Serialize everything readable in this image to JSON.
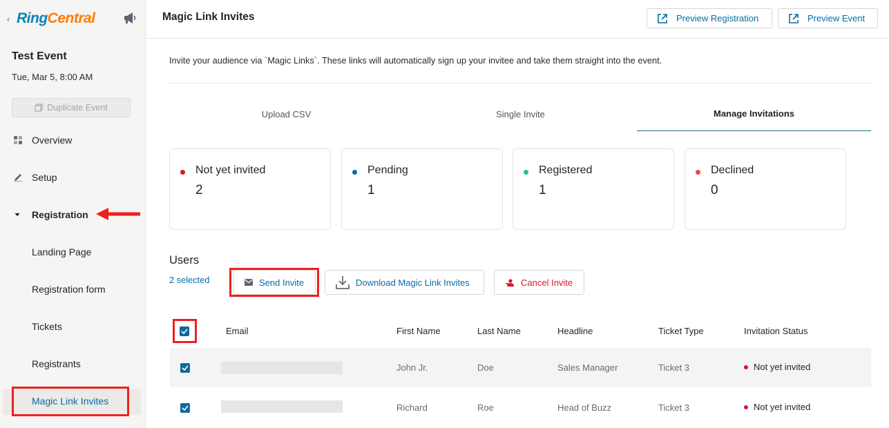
{
  "app": {
    "logo_ring": "Ring",
    "logo_central": "Central",
    "back_icon": "chevron-left-icon",
    "announce_icon": "megaphone-icon"
  },
  "event": {
    "title": "Test Event",
    "date": "Tue, Mar 5, 8:00 AM",
    "duplicate_label": "Duplicate Event"
  },
  "nav": {
    "overview": "Overview",
    "setup": "Setup",
    "registration": "Registration",
    "landing_page": "Landing Page",
    "registration_form": "Registration form",
    "tickets": "Tickets",
    "registrants": "Registrants",
    "magic_link_invites": "Magic Link Invites"
  },
  "header": {
    "title": "Magic Link Invites",
    "preview_registration": "Preview Registration",
    "preview_event": "Preview Event"
  },
  "intro": "Invite your audience via `Magic Links`. These links will automatically sign up your invitee and take them straight into the event.",
  "tabs": [
    {
      "label": "Upload CSV"
    },
    {
      "label": "Single Invite"
    },
    {
      "label": "Manage Invitations"
    }
  ],
  "stats": [
    {
      "label": "Not yet invited",
      "value": "2",
      "color": "#e0102f"
    },
    {
      "label": "Pending",
      "value": "1",
      "color": "#0a6aa6"
    },
    {
      "label": "Registered",
      "value": "1",
      "color": "#1ec47a"
    },
    {
      "label": "Declined",
      "value": "0",
      "color": "#ef4444"
    }
  ],
  "users": {
    "title": "Users",
    "selected": "2 selected",
    "send_invite": "Send Invite",
    "download": "Download Magic Link Invites",
    "cancel_invite": "Cancel Invite"
  },
  "table": {
    "columns": [
      "Email",
      "First Name",
      "Last Name",
      "Headline",
      "Ticket Type",
      "Invitation Status"
    ],
    "rows": [
      {
        "first_name": "John Jr.",
        "last_name": "Doe",
        "headline": "Sales Manager",
        "ticket": "Ticket 3",
        "status": "Not yet invited"
      },
      {
        "first_name": "Richard",
        "last_name": "Roe",
        "headline": "Head of Buzz",
        "ticket": "Ticket 3",
        "status": "Not yet invited"
      }
    ]
  },
  "colors": {
    "accent": "#0a6aa6",
    "danger": "#e0102f",
    "annotation": "#ef1f1f",
    "checkbox": "#0e6a9c"
  }
}
